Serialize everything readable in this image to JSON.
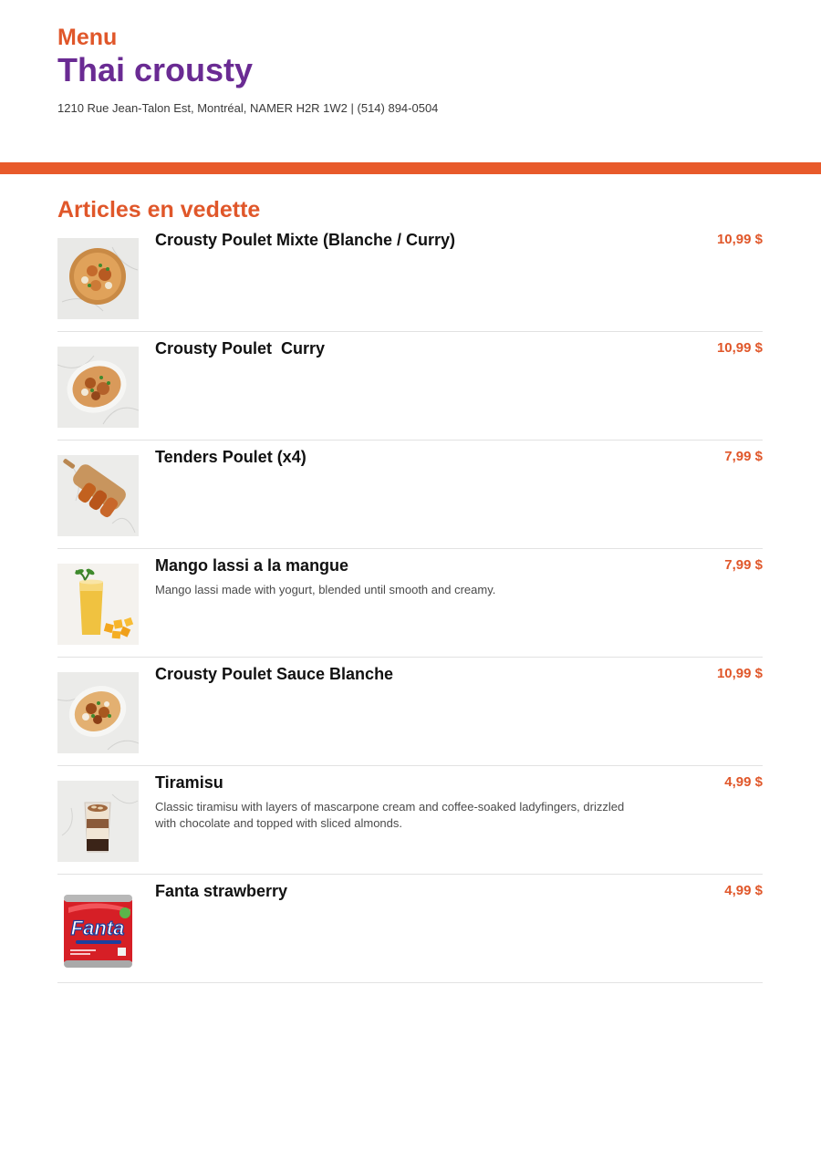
{
  "header": {
    "menu_label": "Menu",
    "restaurant_name": "Thai crousty",
    "address_line": "1210 Rue Jean-Talon Est, Montréal, NAMER H2R 1W2 | (514) 894-0504"
  },
  "colors": {
    "accent": "#e85a2b",
    "title_purple": "#6a2b93",
    "price": "#e0572a"
  },
  "section": {
    "title": "Articles en vedette"
  },
  "items": [
    {
      "name": "Crousty Poulet Mixte (Blanche / Curry)",
      "description": "",
      "price": "10,99 $",
      "icon": "chicken-bowl-photo"
    },
    {
      "name": "Crousty Poulet  Curry",
      "description": "",
      "price": "10,99 $",
      "icon": "chicken-curry-photo"
    },
    {
      "name": "Tenders Poulet (x4)",
      "description": "",
      "price": "7,99 $",
      "icon": "chicken-tenders-photo"
    },
    {
      "name": "Mango lassi a la mangue",
      "description": "Mango lassi made with yogurt, blended until smooth and creamy.",
      "price": "7,99 $",
      "icon": "mango-lassi-photo"
    },
    {
      "name": "Crousty Poulet Sauce Blanche",
      "description": "",
      "price": "10,99 $",
      "icon": "chicken-white-sauce-photo"
    },
    {
      "name": "Tiramisu",
      "description": "Classic tiramisu with layers of mascarpone cream and coffee-soaked ladyfingers, drizzled with chocolate and topped with sliced almonds.",
      "price": "4,99 $",
      "icon": "tiramisu-photo"
    },
    {
      "name": "Fanta strawberry",
      "description": "",
      "price": "4,99 $",
      "icon": "fanta-can-photo",
      "image_text": "Fanta"
    }
  ]
}
